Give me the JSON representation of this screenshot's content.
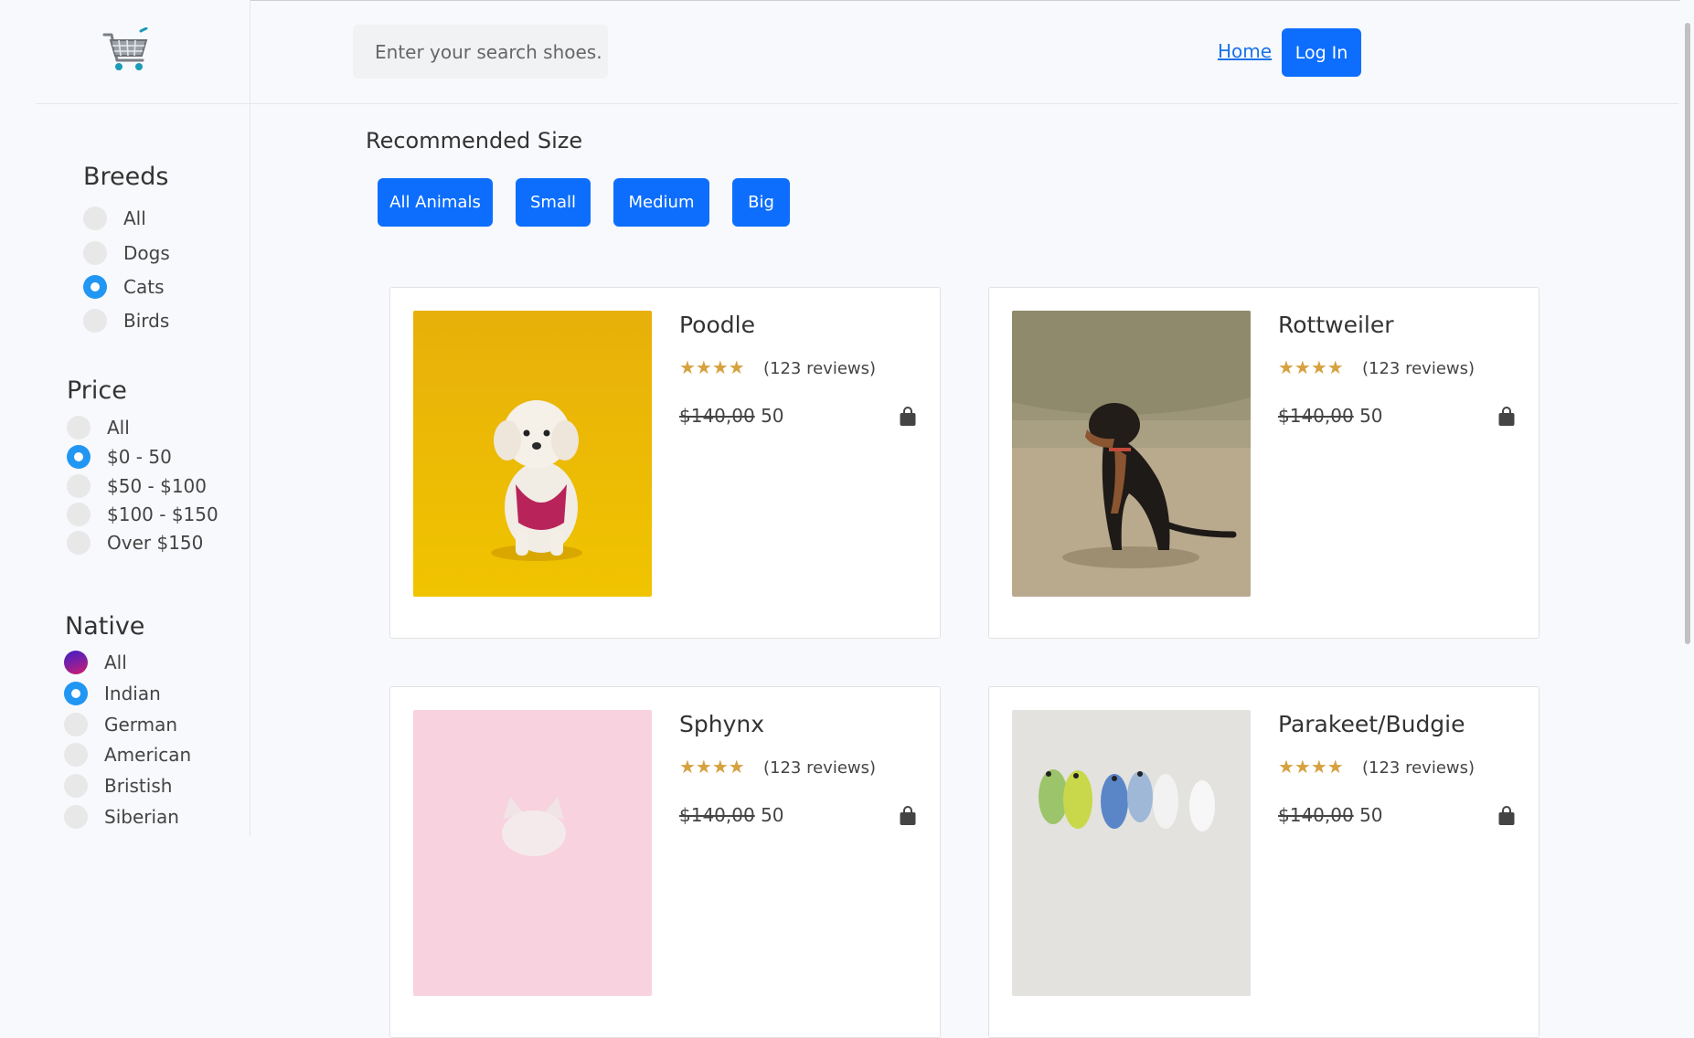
{
  "search": {
    "placeholder": "Enter your search shoes."
  },
  "nav": {
    "home_label": "Home",
    "login_label": "Log In"
  },
  "filters": {
    "breeds": {
      "title": "Breeds",
      "options": [
        "All",
        "Dogs",
        "Cats",
        "Birds"
      ],
      "selected": "Cats"
    },
    "price": {
      "title": "Price",
      "options": [
        "All",
        "$0 - 50",
        "$50 - $100",
        "$100 - $150",
        "Over $150"
      ],
      "selected": "$0 - 50"
    },
    "native": {
      "title": "Native",
      "options": [
        "All",
        "Indian",
        "German",
        "American",
        "Bristish",
        "Siberian"
      ],
      "selected": "Indian"
    }
  },
  "recommended": {
    "title": "Recommended Size",
    "buttons": [
      "All Animals",
      "Small",
      "Medium",
      "Big"
    ]
  },
  "products": [
    {
      "name": "Poodle",
      "stars": "★★★★",
      "reviews": "(123 reviews)",
      "old_price": "$140,00",
      "price": "50",
      "image": "poodle-photo"
    },
    {
      "name": "Rottweiler",
      "stars": "★★★★",
      "reviews": "(123 reviews)",
      "old_price": "$140,00",
      "price": "50",
      "image": "rottweiler-photo"
    },
    {
      "name": "Sphynx",
      "stars": "★★★★",
      "reviews": "(123 reviews)",
      "old_price": "$140,00",
      "price": "50",
      "image": "sphynx-photo"
    },
    {
      "name": "Parakeet/Budgie",
      "stars": "★★★★",
      "reviews": "(123 reviews)",
      "old_price": "$140,00",
      "price": "50",
      "image": "budgie-photo"
    }
  ],
  "colors": {
    "primary": "#0d6efd",
    "radio_checked": "#2196f3",
    "star": "#d6a13f",
    "link": "#1a73e8"
  },
  "icons": [
    "shopping-cart-logo-icon",
    "shopping-bag-icon"
  ]
}
